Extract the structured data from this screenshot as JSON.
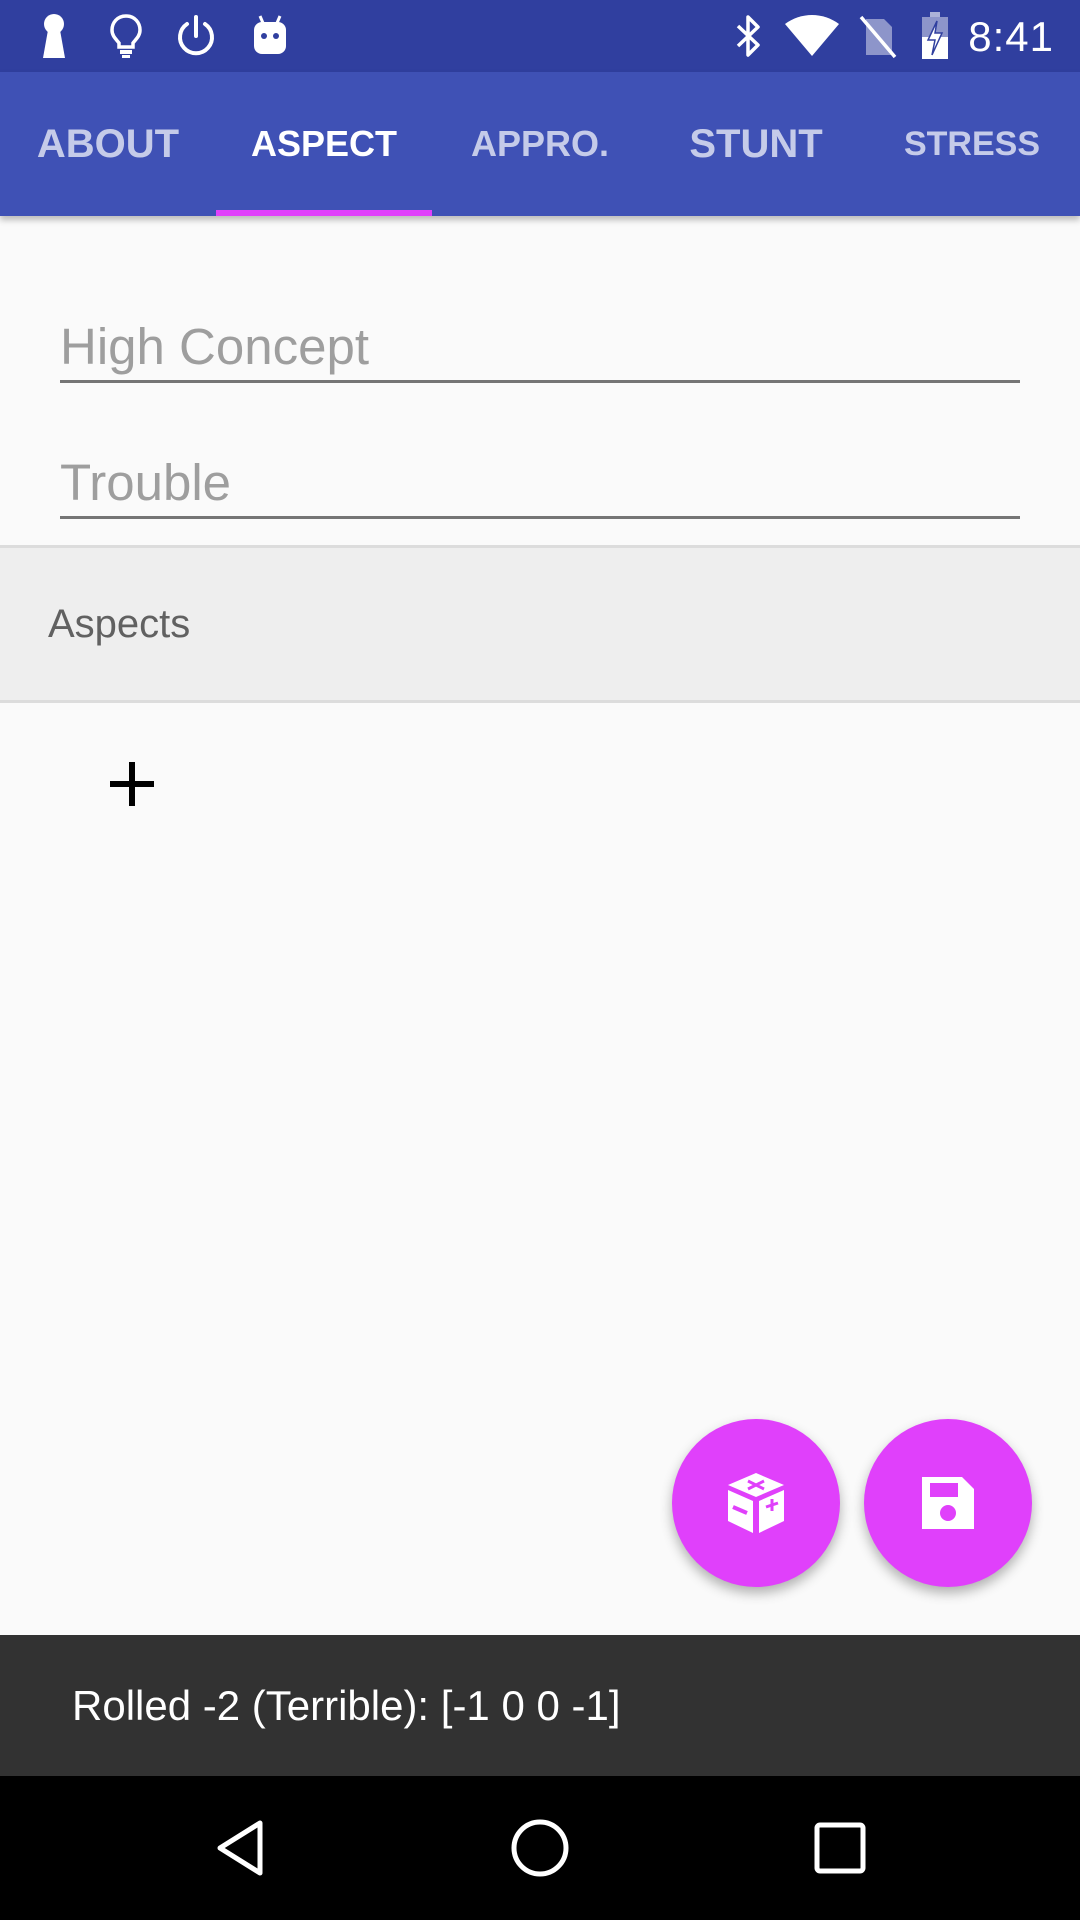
{
  "status_bar": {
    "time": "8:41",
    "left_icons": [
      "keyhole-icon",
      "lightbulb-icon",
      "power-icon",
      "android-icon"
    ],
    "right_icons": [
      "bluetooth-icon",
      "wifi-icon",
      "no-sim-icon",
      "battery-charging-icon"
    ]
  },
  "tabs": [
    {
      "label": "ABOUT"
    },
    {
      "label": "ASPECT"
    },
    {
      "label": "APPRO."
    },
    {
      "label": "STUNT"
    },
    {
      "label": "STRESS"
    }
  ],
  "active_tab": "ASPECT",
  "fields": {
    "high_concept": {
      "placeholder": "High Concept",
      "value": ""
    },
    "trouble": {
      "placeholder": "Trouble",
      "value": ""
    }
  },
  "aspects_section": {
    "title": "Aspects",
    "add_icon": "plus-icon"
  },
  "fabs": [
    {
      "icon": "dice-icon"
    },
    {
      "icon": "save-icon"
    }
  ],
  "snackbar": {
    "text": "Rolled -2 (Terrible): [-1 0 0 -1]"
  },
  "nav": {
    "icons": [
      "back-icon",
      "home-icon",
      "recents-icon"
    ]
  },
  "colors": {
    "status_bar": "#303f9f",
    "primary": "#3f51b5",
    "accent": "#e040fb",
    "snackbar": "#323232"
  }
}
